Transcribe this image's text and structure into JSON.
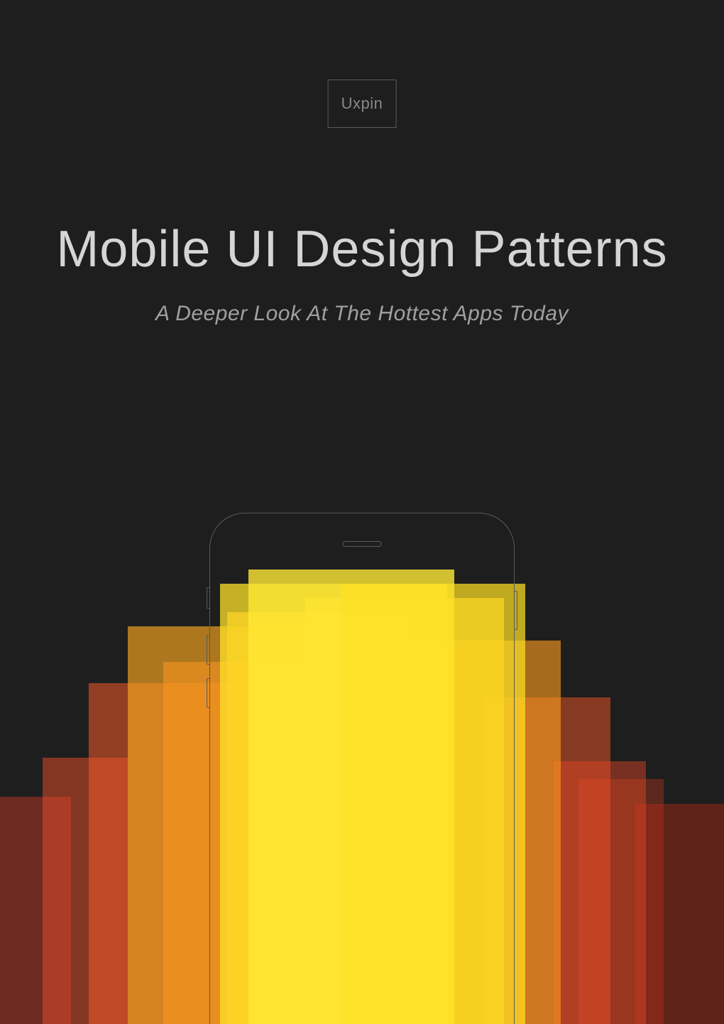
{
  "logo": {
    "text": "Uxpin"
  },
  "title": "Mobile UI Design Patterns",
  "subtitle": "A Deeper Look At The Hottest Apps Today"
}
